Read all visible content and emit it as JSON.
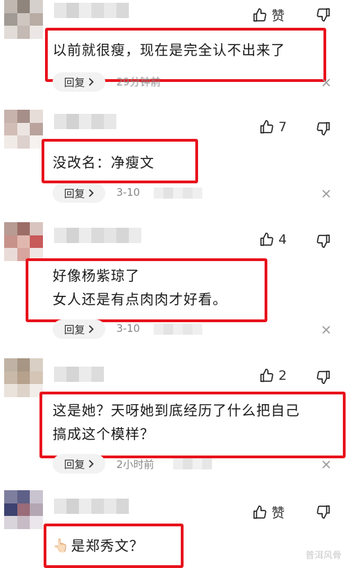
{
  "comments": [
    {
      "like_label": "赞",
      "text_lines": [
        "以前就很瘦，现在是完全认不出来了"
      ],
      "reply_label": "回复",
      "time": "29分钟前"
    },
    {
      "like_label": "7",
      "text_lines": [
        "没改名：净瘦文"
      ],
      "reply_label": "回复",
      "time": "3-10"
    },
    {
      "like_label": "4",
      "text_lines": [
        "好像杨紫琼了",
        "女人还是有点肉肉才好看。"
      ],
      "reply_label": "回复",
      "time": "3-10"
    },
    {
      "like_label": "2",
      "text_lines": [
        "这是她？天呀她到底经历了什么把自己",
        "搞成这个模样？"
      ],
      "reply_label": "回复",
      "time": "2小时前"
    },
    {
      "like_label": "赞",
      "text_lines": [
        "是郑秀文？"
      ],
      "emoji": "👆🏻"
    }
  ],
  "watermark": "普洱风骨",
  "colors": {
    "highlight_border": "#e8131c",
    "reply_bg": "#f2f2f2",
    "meta_text": "#888888"
  },
  "icons": [
    "thumbs-up-icon",
    "thumbs-down-icon",
    "chevron-right-icon",
    "close-icon"
  ]
}
